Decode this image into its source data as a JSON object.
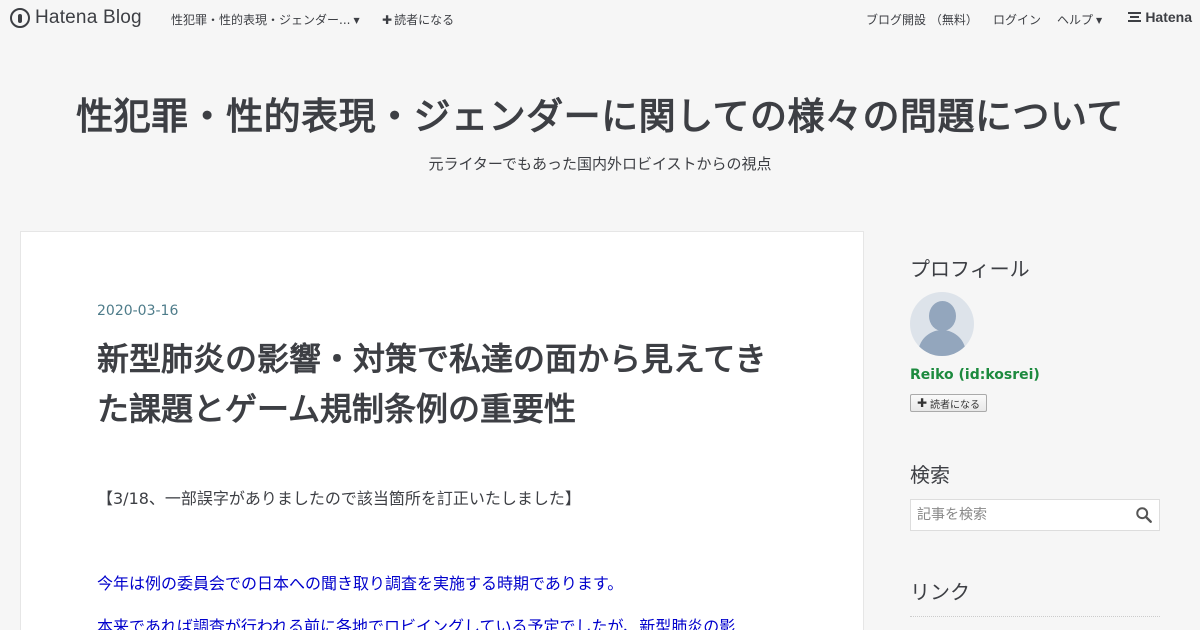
{
  "topbar": {
    "logo_text": "Hatena Blog",
    "blog_menu_label": "性犯罪・性的表現・ジェンダー...",
    "subscribe_label": "読者になる",
    "open_blog_label": "ブログ開設 （無料）",
    "login_label": "ログイン",
    "help_label": "ヘルプ",
    "hatena_label": "Hatena"
  },
  "header": {
    "title": "性犯罪・性的表現・ジェンダーに関しての様々の問題について",
    "description": "元ライターでもあった国内外ロビイストからの視点"
  },
  "article": {
    "date": "2020-03-16",
    "title": "新型肺炎の影響・対策で私達の面から見えてきた課題とゲーム規制条例の重要性",
    "note": "【3/18、一部誤字がありましたので該当箇所を訂正いたしました】",
    "para1": "今年は例の委員会での日本への聞き取り調査を実施する時期であります。",
    "para2": "本来であれば調査が行われる前に各地でロビイングしている予定でしたが、新型肺炎の影"
  },
  "sidebar": {
    "profile_heading": "プロフィール",
    "profile_name": "Reiko  (id:kosrei)",
    "follow_label": "読者になる",
    "search_heading": "検索",
    "search_placeholder": "記事を検索",
    "links_heading": "リンク"
  }
}
